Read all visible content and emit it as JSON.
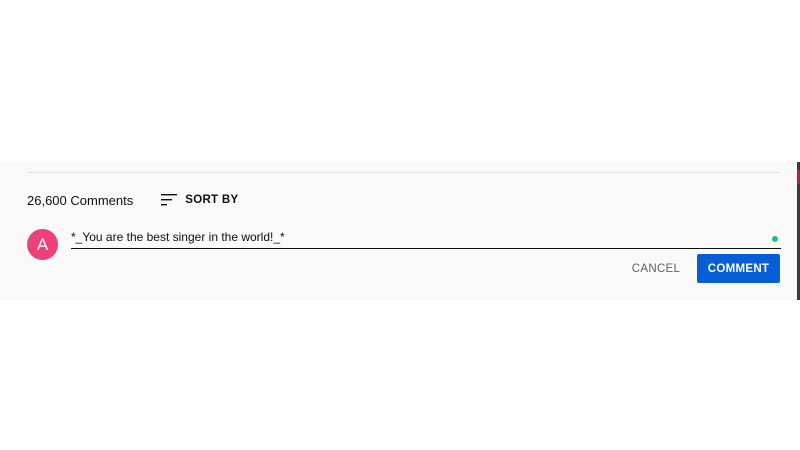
{
  "comments": {
    "count_label": "26,600 Comments",
    "sort_label": "SORT BY",
    "sort_icon": "sort-lines-icon"
  },
  "composer": {
    "avatar_letter": "A",
    "avatar_color": "#ec407a",
    "input_value": "*_You are the best singer in the world!_*",
    "cancel_label": "CANCEL",
    "comment_label": "COMMENT",
    "accent_color": "#065fd4",
    "status_dot_color": "#1ec27a"
  }
}
